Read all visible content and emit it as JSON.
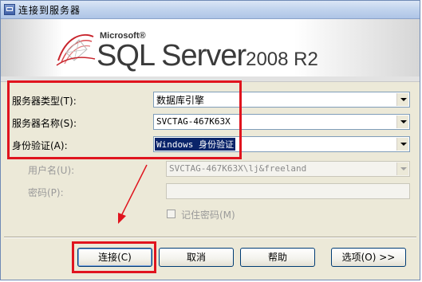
{
  "window": {
    "title": "连接到服务器"
  },
  "banner": {
    "company": "Microsoft®",
    "product": "SQL Server",
    "version": "2008 R2"
  },
  "form": {
    "server_type": {
      "label": "服务器类型(T):",
      "value": "数据库引擎"
    },
    "server_name": {
      "label": "服务器名称(S):",
      "value": "SVCTAG-467K63X"
    },
    "authentication": {
      "label": "身份验证(A):",
      "value": "Windows 身份验证"
    },
    "username": {
      "label": "用户名(U):",
      "value": "SVCTAG-467K63X\\lj&freeland"
    },
    "password": {
      "label": "密码(P):",
      "value": ""
    },
    "remember_password": {
      "label": "记住密码(M)",
      "checked": false
    }
  },
  "buttons": {
    "connect": "连接(C)",
    "cancel": "取消",
    "help": "帮助",
    "options": "选项(O) >>"
  },
  "colors": {
    "annotation_red": "#e0141e",
    "selection_blue": "#0a246a"
  }
}
